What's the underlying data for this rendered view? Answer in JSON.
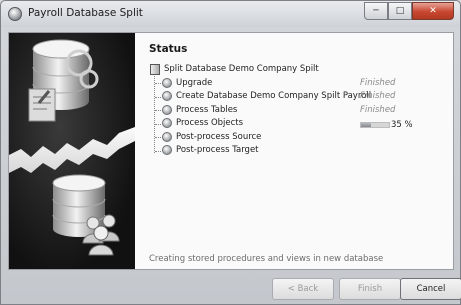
{
  "window": {
    "title": "Payroll Database Split",
    "controls": {
      "minimize": "─",
      "maximize": "□",
      "close": "✕"
    }
  },
  "status": {
    "heading": "Status",
    "root_label": "Split Database Demo Company Spilt",
    "steps": [
      {
        "label": "Upgrade",
        "status": "Finished"
      },
      {
        "label": "Create Database Demo Company Spilt Payroll",
        "status": "Finished"
      },
      {
        "label": "Process Tables",
        "status": "Finished"
      },
      {
        "label": "Process Objects",
        "progress": 0.35,
        "progress_text": "35 %"
      },
      {
        "label": "Post-process Source",
        "status": ""
      },
      {
        "label": "Post-process Target",
        "status": ""
      }
    ],
    "message": "Creating stored procedures and views in new database"
  },
  "buttons": {
    "back": "< Back",
    "finish": "Finish",
    "cancel": "Cancel"
  }
}
